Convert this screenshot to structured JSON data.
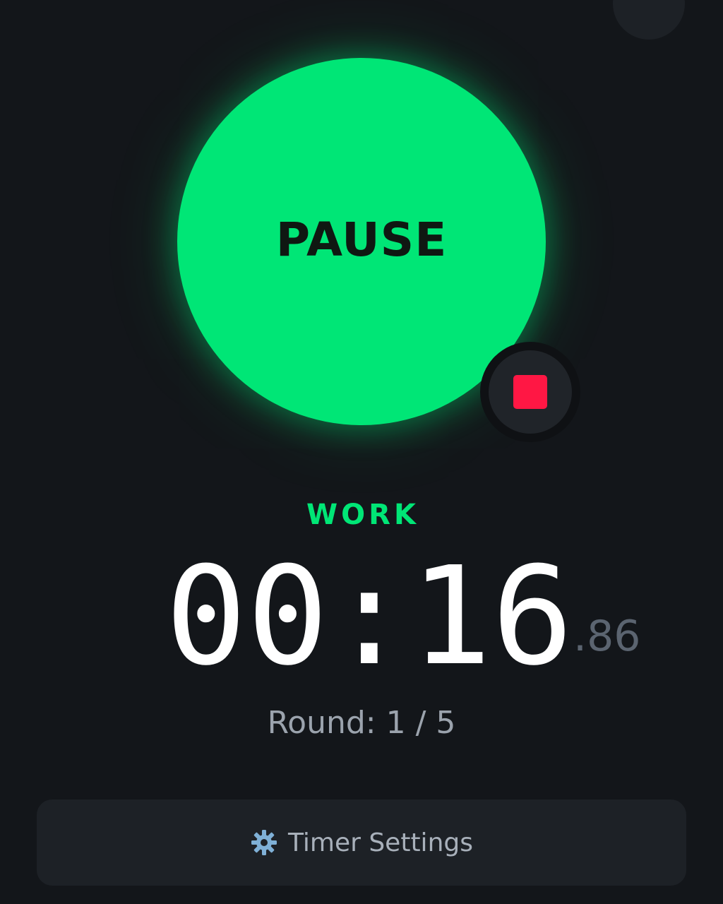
{
  "timer": {
    "pause_label": "PAUSE",
    "stop_icon": "stop-icon",
    "phase": "WORK",
    "time": "00:16",
    "centiseconds": ".86",
    "round": "Round: 1 / 5"
  },
  "settings": {
    "label": "Timer Settings",
    "icon": "gear-icon"
  },
  "colors": {
    "background": "#13161a",
    "accent": "#00e676",
    "stop": "#ff1744",
    "panel": "#1d2126"
  }
}
